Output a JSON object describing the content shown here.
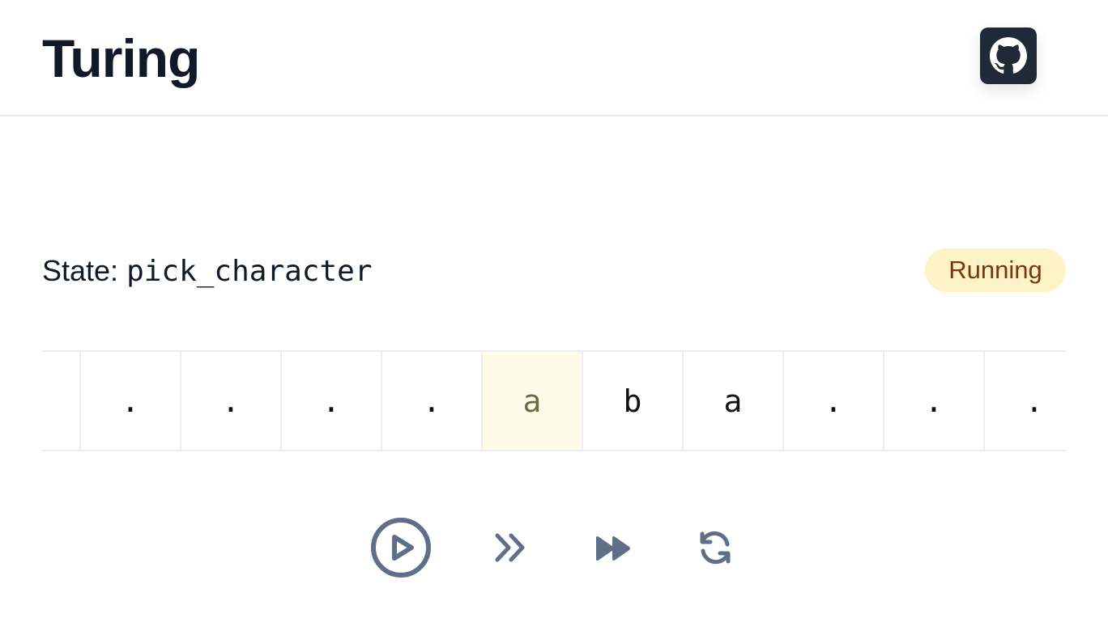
{
  "header": {
    "title": "Turing",
    "github_icon": "github-icon"
  },
  "machine": {
    "state_label": "State:",
    "state_value": "pick_character",
    "status": "Running"
  },
  "tape": {
    "cells": [
      ".",
      ".",
      ".",
      ".",
      ".",
      "a",
      "b",
      "a",
      ".",
      ".",
      "."
    ],
    "head_index": 5
  },
  "controls": {
    "icons": [
      "play-icon",
      "step-icon",
      "fast-forward-icon",
      "reset-icon"
    ]
  },
  "colors": {
    "header_button_bg": "#1f2937",
    "badge_bg": "#fef3c7",
    "badge_text": "#78350f",
    "head_cell_bg": "#fefce8",
    "control_icons": "#5f6f86"
  }
}
